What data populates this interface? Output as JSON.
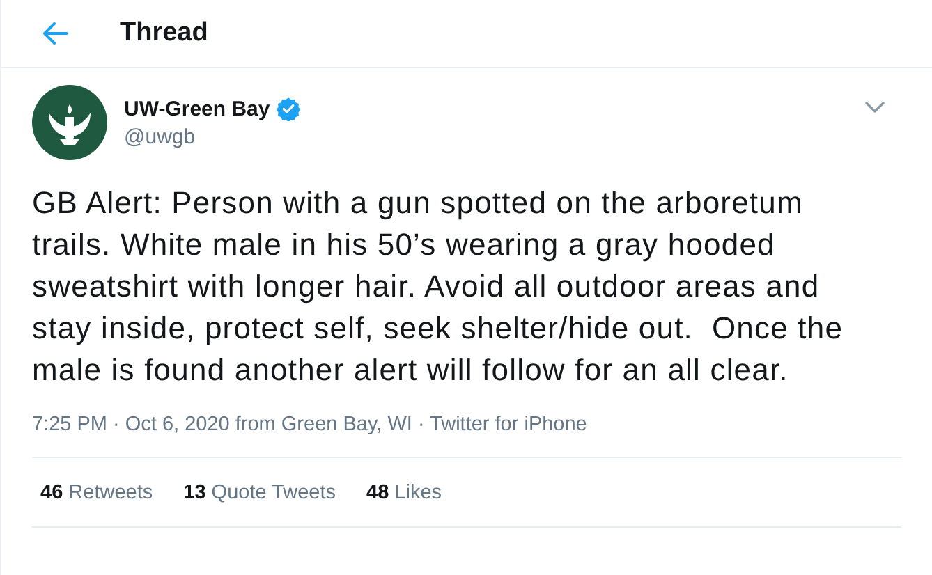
{
  "header": {
    "title": "Thread"
  },
  "tweet": {
    "author": {
      "name": "UW-Green Bay",
      "verified": true,
      "handle": "@uwgb"
    },
    "text": "GB Alert: Person with a gun spotted on the arboretum\ntrails. White male in his 50’s wearing a gray hooded\nsweatshirt with longer hair. Avoid all outdoor areas and\nstay inside, protect self, seek shelter/hide out.  Once the\nmale is found another alert will follow for an all clear.",
    "timestamp": "7:25 PM · Oct 6, 2020 from Green Bay, WI · Twitter for iPhone",
    "stats": [
      {
        "count": "46",
        "label": "Retweets"
      },
      {
        "count": "13",
        "label": "Quote Tweets"
      },
      {
        "count": "48",
        "label": "Likes"
      }
    ]
  }
}
